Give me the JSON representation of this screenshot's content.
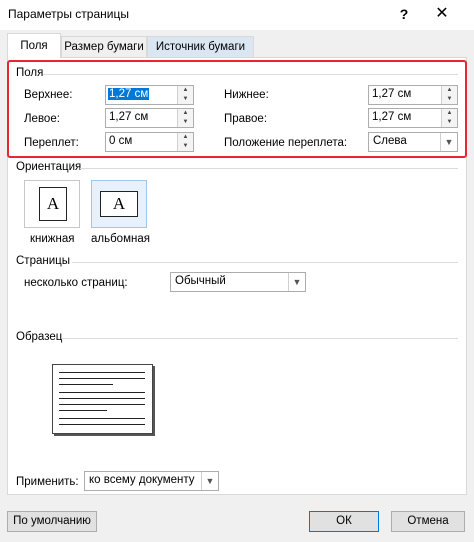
{
  "window": {
    "title": "Параметры страницы",
    "help": "?",
    "close": "✕"
  },
  "tabs": [
    "Поля",
    "Размер бумаги",
    "Источник бумаги"
  ],
  "margins": {
    "group_title": "Поля",
    "top_label": "Верхнее:",
    "top_value": "1,27 см",
    "bottom_label": "Нижнее:",
    "bottom_value": "1,27 см",
    "left_label": "Левое:",
    "left_value": "1,27 см",
    "right_label": "Правое:",
    "right_value": "1,27 см",
    "gutter_label": "Переплет:",
    "gutter_value": "0 см",
    "gutter_pos_label": "Положение переплета:",
    "gutter_pos_value": "Слева"
  },
  "orientation": {
    "group_title": "Ориентация",
    "portrait_label": "книжная",
    "landscape_label": "альбомная",
    "icon_letter": "A",
    "selected": "landscape"
  },
  "pages": {
    "group_title": "Страницы",
    "multiple_label": "несколько страниц:",
    "multiple_value": "Обычный"
  },
  "preview": {
    "group_title": "Образец"
  },
  "apply": {
    "label": "Применить:",
    "value": "ко всему документу"
  },
  "buttons": {
    "default": "По умолчанию",
    "ok": "ОК",
    "cancel": "Отмена"
  }
}
